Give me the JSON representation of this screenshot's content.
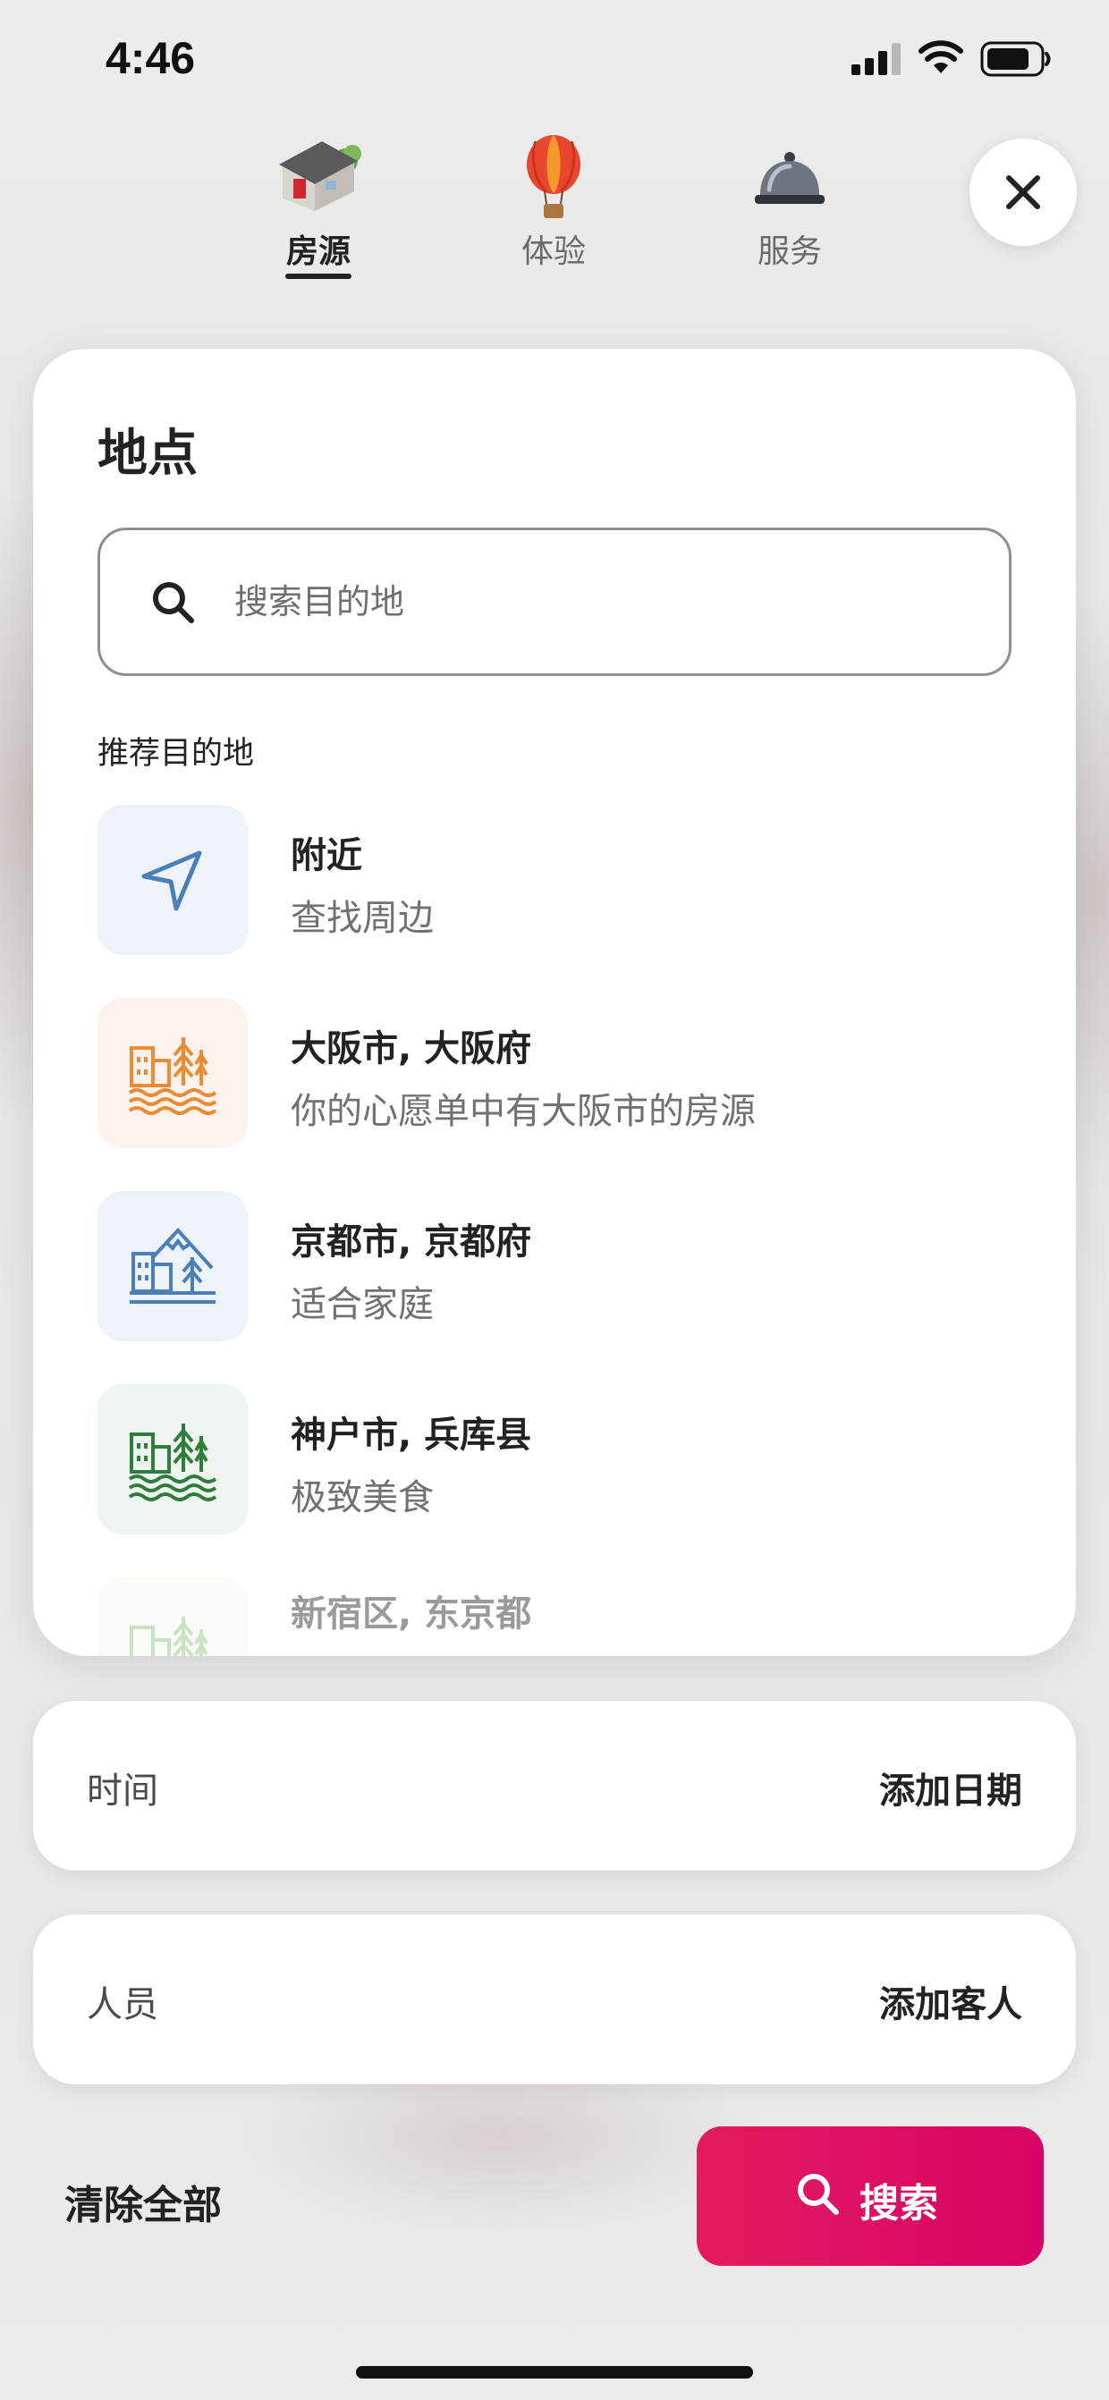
{
  "status_bar": {
    "time": "4:46"
  },
  "top_tabs": [
    {
      "label": "房源",
      "icon": "house-icon",
      "active": true
    },
    {
      "label": "体验",
      "icon": "hot-air-balloon-icon",
      "active": false
    },
    {
      "label": "服务",
      "icon": "service-bell-icon",
      "active": false
    }
  ],
  "location": {
    "title": "地点",
    "search_placeholder": "搜索目的地",
    "section_label": "推荐目的地",
    "destinations": [
      {
        "name": "附近",
        "subtitle": "查找周边",
        "icon": "navigation-arrow-icon",
        "color": "#4a7fb8",
        "tile_bg": "#eef3fa"
      },
      {
        "name": "大阪市, 大阪府",
        "subtitle": "你的心愿单中有大阪市的房源",
        "icon": "city-waterfront-icon",
        "color": "#ec8a35",
        "tile_bg": "#fdf3ec"
      },
      {
        "name": "京都市, 京都府",
        "subtitle": "适合家庭",
        "icon": "city-mountain-icon",
        "color": "#4a7fb8",
        "tile_bg": "#eef3fa"
      },
      {
        "name": "神户市, 兵库县",
        "subtitle": "极致美食",
        "icon": "city-waterfront-icon",
        "color": "#2e7d3a",
        "tile_bg": "#eef4ef"
      },
      {
        "name": "新宿区, 东京都",
        "subtitle": "",
        "icon": "city-waterfront-icon",
        "color": "#8cc37a",
        "tile_bg": "#f1f7ee"
      }
    ]
  },
  "time_row": {
    "label": "时间",
    "value": "添加日期"
  },
  "guests_row": {
    "label": "人员",
    "value": "添加客人"
  },
  "footer": {
    "clear_label": "清除全部",
    "search_label": "搜索"
  },
  "colors": {
    "accent": "#e31c5f",
    "text": "#222222",
    "muted": "#717171"
  }
}
